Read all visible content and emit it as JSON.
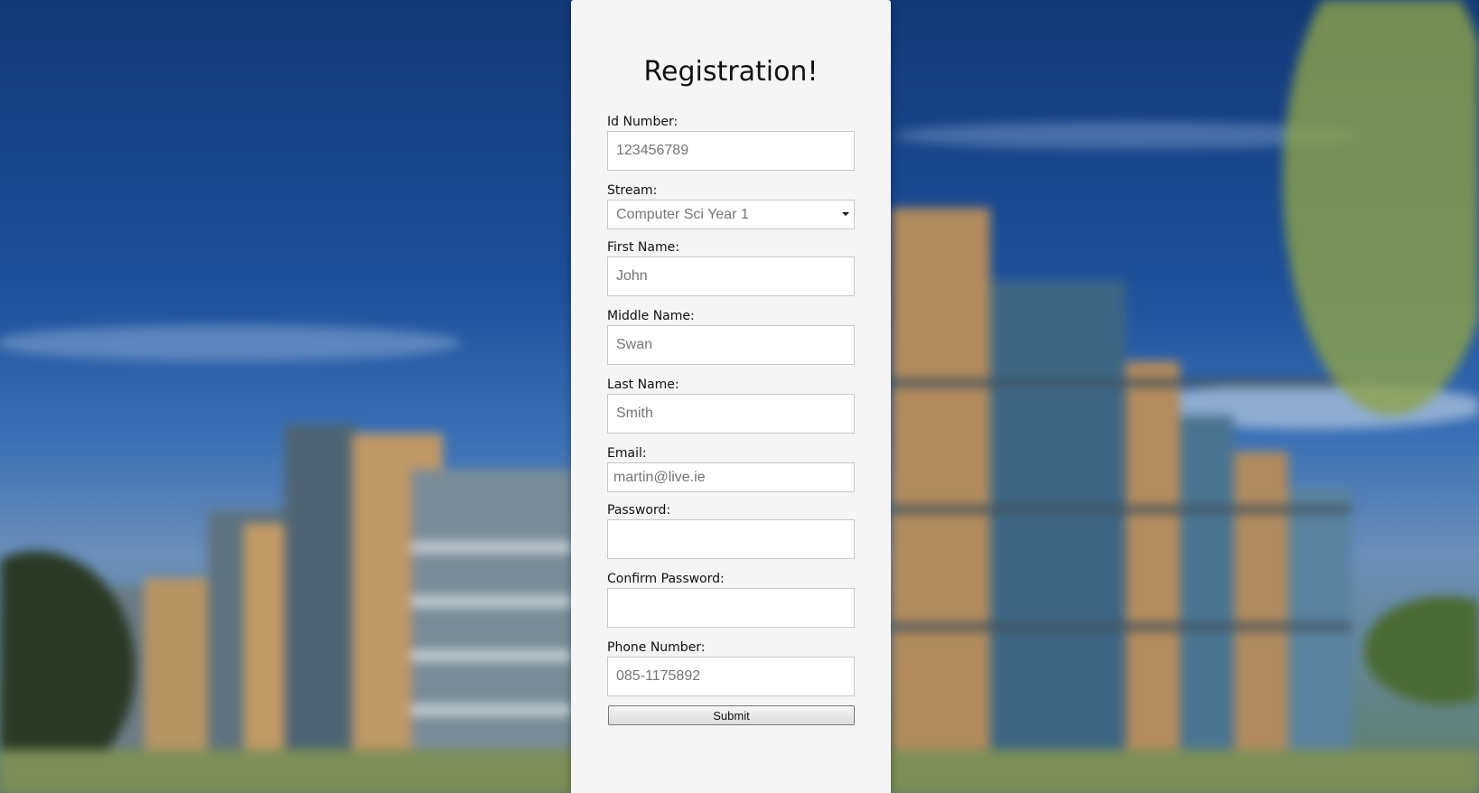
{
  "form": {
    "title": "Registration!",
    "fields": [
      {
        "label": "Id Number:",
        "placeholder": "123456789"
      },
      {
        "label": "Stream:",
        "selected": "Computer Sci Year 1"
      },
      {
        "label": "First Name:",
        "placeholder": "John"
      },
      {
        "label": "Middle Name:",
        "placeholder": "Swan"
      },
      {
        "label": "Last Name:",
        "placeholder": "Smith"
      },
      {
        "label": "Email:",
        "placeholder": "martin@live.ie"
      },
      {
        "label": "Password:",
        "placeholder": ""
      },
      {
        "label": "Confirm Password:",
        "placeholder": ""
      },
      {
        "label": "Phone Number:",
        "placeholder": "085-1175892"
      }
    ],
    "submit_label": "Submit"
  },
  "icons": {
    "select_caret": "chevron-down-icon"
  },
  "colors": {
    "panel_bg": "#f5f5f5",
    "sky": "#1d4f99"
  }
}
